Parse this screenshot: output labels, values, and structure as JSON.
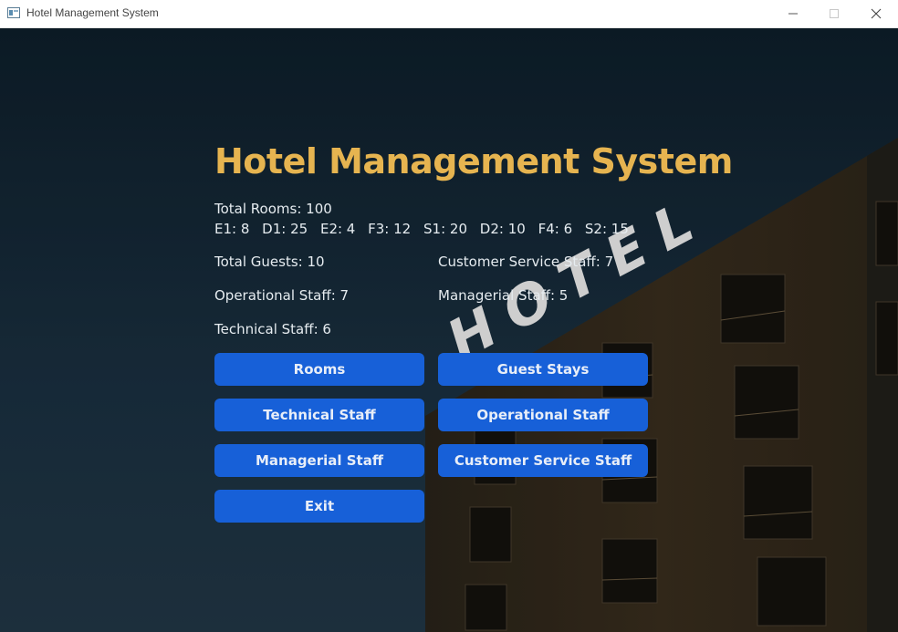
{
  "window": {
    "title": "Hotel Management System",
    "icon": "app-window-icon",
    "controls": {
      "minimize": "—",
      "maximize": "☐",
      "close": "✕"
    }
  },
  "main": {
    "heading": "Hotel Management System",
    "total_rooms": "Total Rooms: 100",
    "room_types": [
      "E1: 8",
      "D1: 25",
      "E2: 4",
      "F3: 12",
      "S1: 20",
      "D2: 10",
      "F4: 6",
      "S2: 15"
    ],
    "total_guests": "Total Guests: 10",
    "customer_service_staff": "Customer Service Staff: 7",
    "operational_staff": "Operational Staff: 7",
    "managerial_staff": "Managerial Staff: 5",
    "technical_staff": "Technical Staff: 6"
  },
  "buttons": {
    "rooms": "Rooms",
    "guest_stays": "Guest Stays",
    "technical_staff": "Technical Staff",
    "operational_staff": "Operational Staff",
    "managerial_staff": "Managerial Staff",
    "customer_service_staff": "Customer Service Staff",
    "exit": "Exit"
  },
  "background": {
    "sign_text": "HOTEL"
  },
  "colors": {
    "heading": "#e6b450",
    "button": "#1760d8",
    "text": "#e6ecf0"
  }
}
